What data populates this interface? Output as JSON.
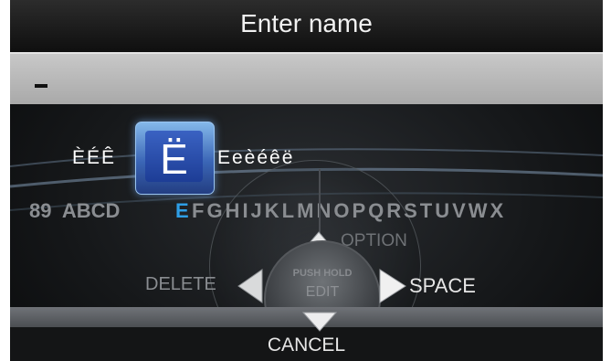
{
  "title": "Enter name",
  "name_value": "",
  "variants_left": "ÈÉÊ",
  "selected_char": "Ë",
  "variants_right": "Eeèéêë",
  "alphabet": {
    "before_highlight": "89  ABCD",
    "highlight": "E",
    "after_highlight": "FGHIJKLMNOPQRSTUVWX"
  },
  "knob": {
    "push_label": "PUSH HOLD",
    "edit_label": "EDIT"
  },
  "controls": {
    "option": "OPTION",
    "delete": "DELETE",
    "space": "SPACE",
    "cancel": "CANCEL"
  },
  "colors": {
    "highlight": "#2e9ee6",
    "tile": "#3b66b6"
  }
}
